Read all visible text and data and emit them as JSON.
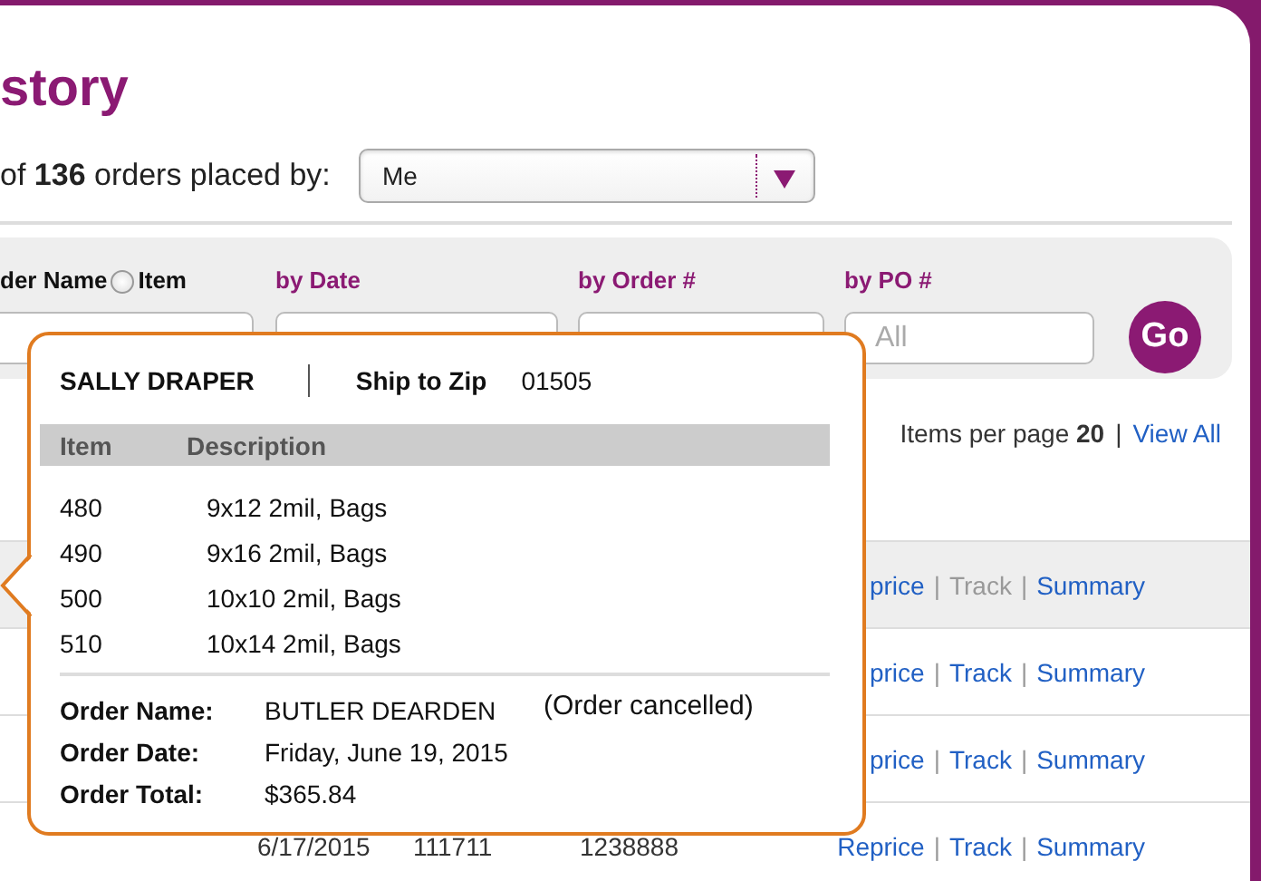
{
  "page": {
    "title": "story"
  },
  "order_count": "of **136** orders placed by:",
  "placed_by": {
    "value": "Me"
  },
  "filters": {
    "name_label": "der Name",
    "item_option": {
      "label": "Item",
      "selected": false
    },
    "date_label": "by Date",
    "order_label": "by Order #",
    "po_label": "by PO #",
    "po_placeholder": "All",
    "go": "Go"
  },
  "pagination": {
    "label": "Items per page **20**",
    "separator": "|",
    "view_all": "View All"
  },
  "rows": [
    {
      "selected": true,
      "actions": [
        {
          "label": "price",
          "disabled": false
        },
        {
          "separator": "|",
          "label": "Track",
          "disabled": true
        },
        {
          "separator": "|",
          "label": "Summary",
          "disabled": false
        }
      ]
    },
    {
      "selected": false,
      "actions": [
        {
          "label": "price",
          "disabled": false
        },
        {
          "separator": "|",
          "label": "Track",
          "disabled": false
        },
        {
          "separator": "|",
          "label": "Summary",
          "disabled": false
        }
      ]
    },
    {
      "selected": false,
      "actions": [
        {
          "label": "price",
          "disabled": false
        },
        {
          "separator": "|",
          "label": "Track",
          "disabled": false
        },
        {
          "separator": "|",
          "label": "Summary",
          "disabled": false
        }
      ]
    },
    {
      "selected": false,
      "date": "6/17/2015",
      "order": "111711",
      "po": "1238888",
      "actions": [
        {
          "label": "Reprice",
          "disabled": false
        },
        {
          "separator": "|",
          "label": "Track",
          "disabled": false
        },
        {
          "separator": "|",
          "label": "Summary",
          "disabled": false
        }
      ]
    }
  ],
  "popover": {
    "customer": "SALLY DRAPER",
    "zip_label": "Ship to Zip",
    "zip": "01505",
    "columns": [
      "Item",
      "Description"
    ],
    "items": [
      {
        "item": "480",
        "description": "9x12 2mil, Bags"
      },
      {
        "item": "490",
        "description": "9x16 2mil, Bags"
      },
      {
        "item": "500",
        "description": "10x10 2mil, Bags"
      },
      {
        "item": "510",
        "description": "10x14 2mil, Bags"
      }
    ],
    "details": [
      {
        "label": "Order Name:",
        "value": "BUTLER DEARDEN",
        "note": "(Order cancelled)"
      },
      {
        "label": "Order Date:",
        "value": "Friday, June 19, 2015"
      },
      {
        "label": "Order Total:",
        "value": "$365.84"
      }
    ]
  }
}
